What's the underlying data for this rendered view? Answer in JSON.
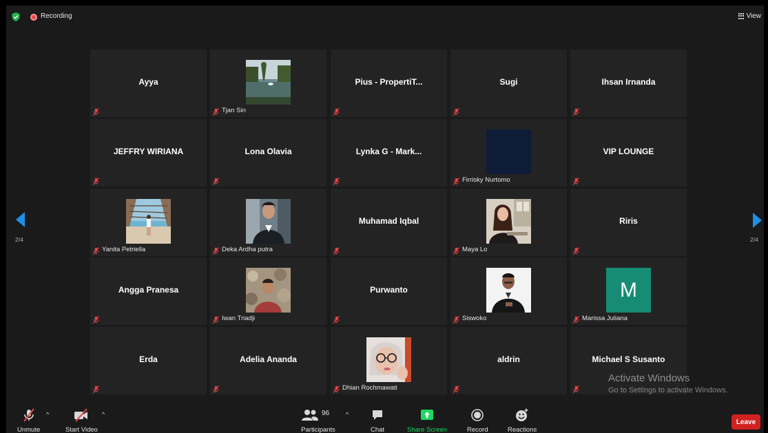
{
  "topbar": {
    "recording_label": "Recording",
    "view_label": "View"
  },
  "pagination": {
    "left_page": "2/4",
    "right_page": "2/4"
  },
  "tiles": [
    {
      "name": "Ayya",
      "type": "name"
    },
    {
      "name": "Tjan Sin",
      "type": "photo",
      "photo": "lake-photo"
    },
    {
      "name": "Pius - PropertiT...",
      "type": "name"
    },
    {
      "name": "Sugi",
      "type": "name"
    },
    {
      "name": "Ihsan Irnanda",
      "type": "name"
    },
    {
      "name": "JEFFRY WIRIANA",
      "type": "name"
    },
    {
      "name": "Lona Olavia",
      "type": "name"
    },
    {
      "name": "Lynka G - Mark...",
      "type": "name"
    },
    {
      "name": "Firrisky Nurtomo",
      "type": "photo",
      "photo": "dark-photo"
    },
    {
      "name": "VIP LOUNGE",
      "type": "name"
    },
    {
      "name": "Yanita Petriella",
      "type": "photo",
      "photo": "beach-photo"
    },
    {
      "name": "Deka Ardha putra",
      "type": "photo",
      "photo": "man-suit-photo"
    },
    {
      "name": "Muhamad Iqbal",
      "type": "name"
    },
    {
      "name": "Maya Lo",
      "type": "photo",
      "photo": "woman-office-photo"
    },
    {
      "name": "Riris",
      "type": "name"
    },
    {
      "name": "Angga Pranesa",
      "type": "name"
    },
    {
      "name": "Iwan Triadji",
      "type": "photo",
      "photo": "man-flowers-photo"
    },
    {
      "name": "Purwanto",
      "type": "name"
    },
    {
      "name": "Siswoko",
      "type": "photo",
      "photo": "man-black-photo"
    },
    {
      "name": "Marissa Juliana",
      "type": "avatar",
      "initial": "M",
      "color": "#168c74"
    },
    {
      "name": "Erda",
      "type": "name"
    },
    {
      "name": "Adelia Ananda",
      "type": "name"
    },
    {
      "name": "Dhian Rochmawati",
      "type": "photo",
      "photo": "woman-glasses-photo"
    },
    {
      "name": "aldrin",
      "type": "name"
    },
    {
      "name": "Michael S Susanto",
      "type": "name"
    }
  ],
  "watermark": {
    "title": "Activate Windows",
    "subtitle": "Go to Settings to activate Windows."
  },
  "toolbar": {
    "unmute": "Unmute",
    "start_video": "Start Video",
    "participants": "Participants",
    "participant_count": "96",
    "chat": "Chat",
    "share_screen": "Share Screen",
    "record": "Record",
    "reactions": "Reactions",
    "leave": "Leave"
  },
  "colors": {
    "background": "#1a1a1a",
    "tile": "#232323",
    "muted_red": "#e5484d",
    "share_green": "#1ed760",
    "leave_red": "#d12222",
    "nav_blue": "#1e90e8"
  }
}
